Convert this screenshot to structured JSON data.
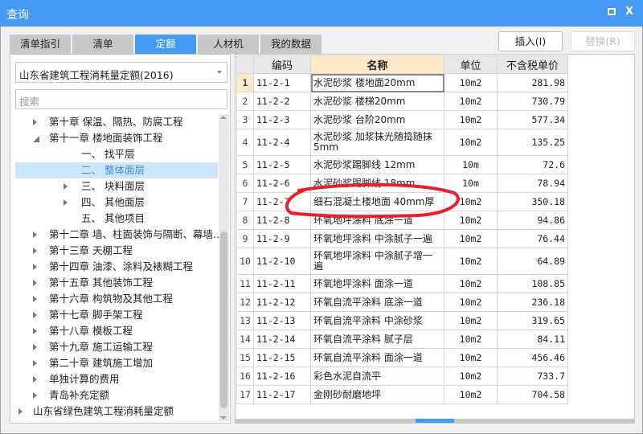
{
  "window": {
    "title": "查询",
    "maximize_icon": "maximize-icon",
    "close_label": "X"
  },
  "tabs": [
    "清单指引",
    "清单",
    "定额",
    "人材机",
    "我的数据"
  ],
  "active_tab": 2,
  "buttons": {
    "insert": "插入(I)",
    "replace": "替换(R)"
  },
  "library_select": "山东省建筑工程消耗量定额(2016)",
  "search_placeholder": "搜索",
  "tree": [
    {
      "label": "第十章 保温、隔热、防腐工程",
      "level": 1,
      "state": "closed"
    },
    {
      "label": "第十一章 楼地面装饰工程",
      "level": 1,
      "state": "open"
    },
    {
      "label": "一、 找平层",
      "level": 2,
      "state": "leaf"
    },
    {
      "label": "二、 整体面层",
      "level": 2,
      "state": "leaf",
      "selected": true
    },
    {
      "label": "三、 块料面层",
      "level": 2,
      "state": "closed"
    },
    {
      "label": "四、 其他面层",
      "level": 2,
      "state": "closed"
    },
    {
      "label": "五、 其他项目",
      "level": 2,
      "state": "leaf"
    },
    {
      "label": "第十二章 墙、柱面装饰与隔断、幕墙...",
      "level": 1,
      "state": "closed"
    },
    {
      "label": "第十三章 天棚工程",
      "level": 1,
      "state": "closed"
    },
    {
      "label": "第十四章 油漆、涂料及裱糊工程",
      "level": 1,
      "state": "closed"
    },
    {
      "label": "第十五章 其他装饰工程",
      "level": 1,
      "state": "closed"
    },
    {
      "label": "第十六章 构筑物及其他工程",
      "level": 1,
      "state": "closed"
    },
    {
      "label": "第十七章 脚手架工程",
      "level": 1,
      "state": "closed"
    },
    {
      "label": "第十八章 模板工程",
      "level": 1,
      "state": "closed"
    },
    {
      "label": "第十九章 施工运输工程",
      "level": 1,
      "state": "closed"
    },
    {
      "label": "第二十章 建筑施工增加",
      "level": 1,
      "state": "closed"
    },
    {
      "label": "单独计算的费用",
      "level": 1,
      "state": "closed"
    },
    {
      "label": "青岛补充定额",
      "level": 1,
      "state": "closed"
    },
    {
      "label": "山东省绿色建筑工程消耗量定额",
      "level": 0,
      "state": "closed"
    }
  ],
  "table": {
    "columns": [
      "编码",
      "名称",
      "单位",
      "不含税单价"
    ],
    "rows": [
      [
        "1",
        "11-2-1",
        "水泥砂浆 楼地面20mm",
        "10m2",
        "281.98"
      ],
      [
        "2",
        "11-2-2",
        "水泥砂浆 楼梯20mm",
        "10m2",
        "730.79"
      ],
      [
        "3",
        "11-2-3",
        "水泥砂浆 台阶20mm",
        "10m2",
        "577.34"
      ],
      [
        "4",
        "11-2-4",
        "水泥砂浆 加浆抹光随捣随抹5mm",
        "10m2",
        "135.25"
      ],
      [
        "5",
        "11-2-5",
        "水泥砂浆踢脚线 12mm",
        "10m",
        "72.6"
      ],
      [
        "6",
        "11-2-6",
        "水泥砂浆踢脚线 18mm",
        "10m",
        "78.94"
      ],
      [
        "7",
        "11-2-7",
        "细石混凝土楼地面 40mm厚",
        "10m2",
        "350.18"
      ],
      [
        "8",
        "11-2-8",
        "环氧地坪涂料 底涂一道",
        "10m2",
        "94.86"
      ],
      [
        "9",
        "11-2-9",
        "环氧地坪涂料 中涂腻子一遍",
        "10m2",
        "76.44"
      ],
      [
        "10",
        "11-2-10",
        "环氧地坪涂料 中涂腻子增一遍",
        "10m2",
        "64.89"
      ],
      [
        "11",
        "11-2-11",
        "环氧地坪涂料 面涂一道",
        "10m2",
        "108.85"
      ],
      [
        "12",
        "11-2-12",
        "环氧自流平涂料 底涂一道",
        "10m2",
        "236.18"
      ],
      [
        "13",
        "11-2-13",
        "环氧自流平涂料 中涂砂浆",
        "10m2",
        "319.65"
      ],
      [
        "14",
        "11-2-14",
        "环氧自流平涂料 腻子层",
        "10m2",
        "84.11"
      ],
      [
        "15",
        "11-2-15",
        "环氧自流平涂料 面涂一道",
        "10m2",
        "456.46"
      ],
      [
        "16",
        "11-2-16",
        "彩色水泥自流平",
        "10m2",
        "733.7"
      ],
      [
        "17",
        "11-2-17",
        "金刚砂耐磨地坪",
        "10m2",
        "704.58"
      ]
    ],
    "current_row": 0,
    "tall_rows": [
      3,
      9
    ],
    "highlighted_row": 6
  },
  "colors": {
    "accent": "#4499f4",
    "annotation": "#e8202a"
  }
}
